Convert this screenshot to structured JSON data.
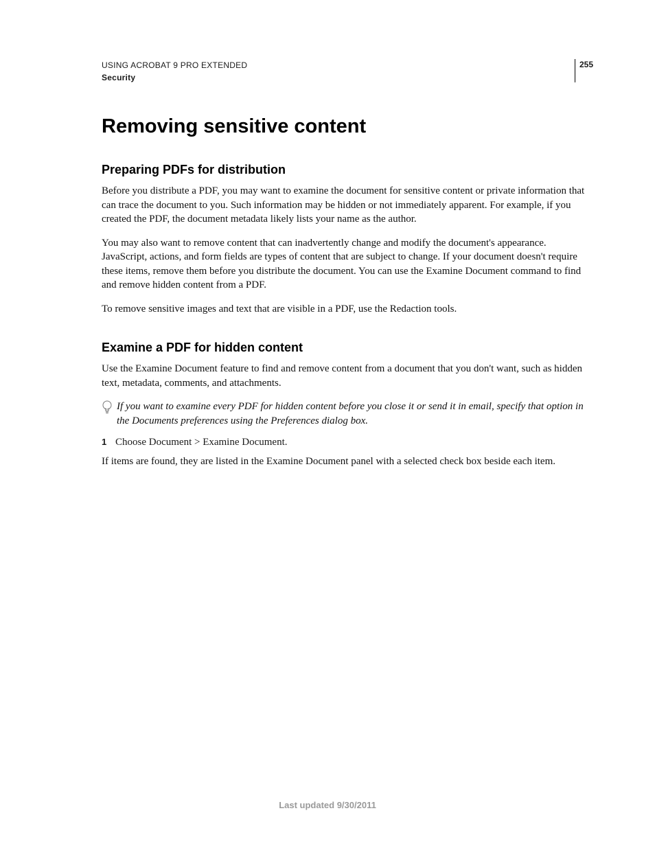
{
  "header": {
    "title": "USING ACROBAT 9 PRO EXTENDED",
    "section": "Security",
    "page_number": "255"
  },
  "main": {
    "h1": "Removing sensitive content",
    "sections": [
      {
        "h2": "Preparing PDFs for distribution",
        "paragraphs": [
          "Before you distribute a PDF, you may want to examine the document for sensitive content or private information that can trace the document to you. Such information may be hidden or not immediately apparent. For example, if you created the PDF, the document metadata likely lists your name as the author.",
          "You may also want to remove content that can inadvertently change and modify the document's appearance. JavaScript, actions, and form fields are types of content that are subject to change. If your document doesn't require these items, remove them before you distribute the document. You can use the Examine Document command to find and remove hidden content from a PDF.",
          "To remove sensitive images and text that are visible in a PDF, use the Redaction tools."
        ]
      },
      {
        "h2": "Examine a PDF for hidden content",
        "intro": "Use the Examine Document feature to find and remove content from a document that you don't want, such as hidden text, metadata, comments, and attachments.",
        "tip": "If you want to examine every PDF for hidden content before you close it or send it in email, specify that option in the Documents preferences using the Preferences dialog box.",
        "steps": [
          {
            "num": "1",
            "text": "Choose Document > Examine Document."
          }
        ],
        "after_steps": "If items are found, they are listed in the Examine Document panel with a selected check box beside each item."
      }
    ]
  },
  "footer": {
    "updated": "Last updated 9/30/2011"
  },
  "icons": {
    "tip": "lightbulb-icon"
  }
}
